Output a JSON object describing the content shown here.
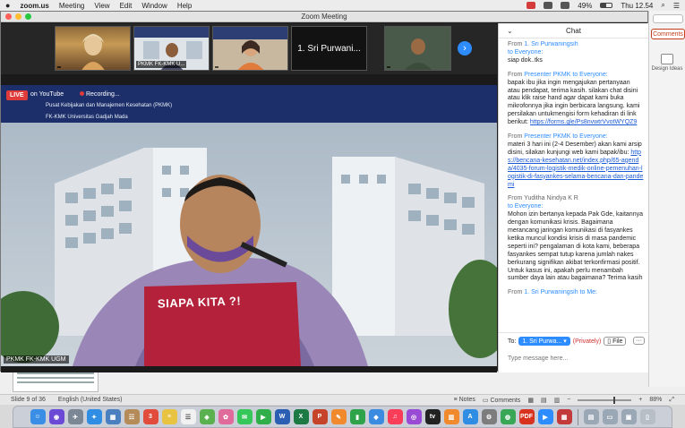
{
  "menubar": {
    "app": "zoom.us",
    "items": [
      "Meeting",
      "View",
      "Edit",
      "Window",
      "Help"
    ],
    "battery": "49%",
    "clock": "Thu 12.54"
  },
  "zoom_window": {
    "title": "Zoom Meeting",
    "thumbnails": [
      {
        "caption": ""
      },
      {
        "caption": "PKMK FK-KMK U..."
      },
      {
        "caption": ""
      },
      {
        "caption": "1.  Sri Purwani..."
      },
      {
        "caption": ""
      }
    ],
    "main_video": {
      "live_badge": "LIVE",
      "youtube_label": "on YouTube",
      "recording_label": "Recording...",
      "banner_line1": "Pusat Kebijakan dan Manajemen Kesehatan (PKMK)",
      "banner_line2": "FK-KMK Universitas Gadjah Mada",
      "banner_text": "SIAPA KITA ?!",
      "speaker_name": "PKMK FK-KMK UGM"
    }
  },
  "chat": {
    "title": "Chat",
    "messages": [
      {
        "from": "1.  Sri Purwaningsih",
        "to": "to Everyone:",
        "text": "siap dok..tks"
      },
      {
        "from": "Presenter PKMK",
        "to": " to Everyone:",
        "text": "bapak ibu jika ingin mengajukan pertanyaan atau pendapat, terima kasih. silakan chat disini atau klik raise hand agar dapat kami buka mikrofonnya jika ingin berbicara langsung. kami persilakan untukmengisi form kehadiran di link berikut: ",
        "link": "https://forms.gle/Ps8nvwtrVvotWYQZ9"
      },
      {
        "from": "Presenter PKMK",
        "to": " to Everyone:",
        "text": "materi 3 hari ini (2-4 Desember) akan kami arsip disini, silakan kunjungi web kami bapak/ibu: ",
        "link": "https://bencana-kesehatan.net/index.php/65-agenda/4035-forum-logistik-medik-online-pemenuhan-logistik-di-fasyankes-selama-bencana-dan-pandemi"
      },
      {
        "from": "Yuditha Nindya K R",
        "to": "to Everyone:",
        "text": "Mohon izin bertanya kepada Pak Gde, kaitannya dengan komunikasi krisis. Bagaimana merancang jaringan komunikasi di fasyankes ketika muncul kondisi krisis di masa pandemic seperti ini? pengalaman di kota kami, beberapa fasyankes sempat tutup karena jumlah nakes berkurang signifikan akibat terkonfirmasi positif. Untuk kasus ini, apakah perlu menambah sumber daya lain atau bagaimana? Terima kasih"
      },
      {
        "from": "1.  Sri Purwaningsih",
        "to": " to Me:",
        "text": ""
      }
    ],
    "to_label": "To:",
    "recipient": "1. Sri Purwa...",
    "privately": "(Privately)",
    "file_label": "File",
    "more_label": "···",
    "input_placeholder": "Type message here..."
  },
  "powerpoint": {
    "comments_label": "Comments",
    "design_label": "Design Ideas",
    "slide_info": "Slide 9 of 36",
    "language": "English (United States)",
    "notes_label": "Notes",
    "status_comments_label": "Comments",
    "zoom_level": "88%"
  },
  "dock": {
    "icons": [
      {
        "name": "finder-icon",
        "glyph": "☺",
        "color": "#3a8ee6"
      },
      {
        "name": "siri-icon",
        "glyph": "◉",
        "color": "#6b4bd6"
      },
      {
        "name": "launchpad-icon",
        "glyph": "✈",
        "color": "#7c8796"
      },
      {
        "name": "safari-icon",
        "glyph": "✦",
        "color": "#2f8de4"
      },
      {
        "name": "photo-slideshow-icon",
        "glyph": "▦",
        "color": "#4a7fc0"
      },
      {
        "name": "contacts-icon",
        "glyph": "☷",
        "color": "#b58b5a"
      },
      {
        "name": "calendar-icon",
        "glyph": "3",
        "color": "#e24c3c"
      },
      {
        "name": "notes-icon",
        "glyph": "≡",
        "color": "#e8c341"
      },
      {
        "name": "reminders-icon",
        "glyph": "☰",
        "color": "#f1f1f1"
      },
      {
        "name": "maps-icon",
        "glyph": "◈",
        "color": "#5bb04f"
      },
      {
        "name": "photos-icon",
        "glyph": "✿",
        "color": "#e06a9a"
      },
      {
        "name": "messages-icon",
        "glyph": "✉",
        "color": "#35c759"
      },
      {
        "name": "facetime-icon",
        "glyph": "▶",
        "color": "#2fae4a"
      },
      {
        "name": "word-icon",
        "glyph": "W",
        "color": "#2b5fb4"
      },
      {
        "name": "excel-icon",
        "glyph": "X",
        "color": "#1e7a45"
      },
      {
        "name": "powerpoint-icon",
        "glyph": "P",
        "color": "#c6452a"
      },
      {
        "name": "pages-icon",
        "glyph": "✎",
        "color": "#f08a2c"
      },
      {
        "name": "numbers-icon",
        "glyph": "▮",
        "color": "#2fa34a"
      },
      {
        "name": "keynote-icon",
        "glyph": "◆",
        "color": "#3b8be0"
      },
      {
        "name": "music-icon",
        "glyph": "♫",
        "color": "#fa3e5a"
      },
      {
        "name": "podcasts-icon",
        "glyph": "◎",
        "color": "#9a4bd6"
      },
      {
        "name": "tv-icon",
        "glyph": "tv",
        "color": "#222222"
      },
      {
        "name": "books-icon",
        "glyph": "▥",
        "color": "#f08a2c"
      },
      {
        "name": "app-store-icon",
        "glyph": "A",
        "color": "#2f8de4"
      },
      {
        "name": "system-preferences-icon",
        "glyph": "⚙",
        "color": "#7d7d7d"
      },
      {
        "name": "chrome-icon",
        "glyph": "◍",
        "color": "#3aa757"
      },
      {
        "name": "pdf-icon",
        "glyph": "PDF",
        "color": "#d9331f"
      },
      {
        "name": "zoom-icon",
        "glyph": "▶",
        "color": "#2d8cff"
      },
      {
        "name": "app-grid-icon",
        "glyph": "▦",
        "color": "#c23a3a"
      },
      {
        "name": "preview-icon",
        "glyph": "▤",
        "color": "#9aa7b5"
      },
      {
        "name": "screenshot-icon",
        "glyph": "▭",
        "color": "#9aa7b5"
      },
      {
        "name": "downloads-icon",
        "glyph": "▣",
        "color": "#9aa7b5"
      },
      {
        "name": "trash-icon",
        "glyph": "▯",
        "color": "#b8bec6"
      }
    ]
  }
}
